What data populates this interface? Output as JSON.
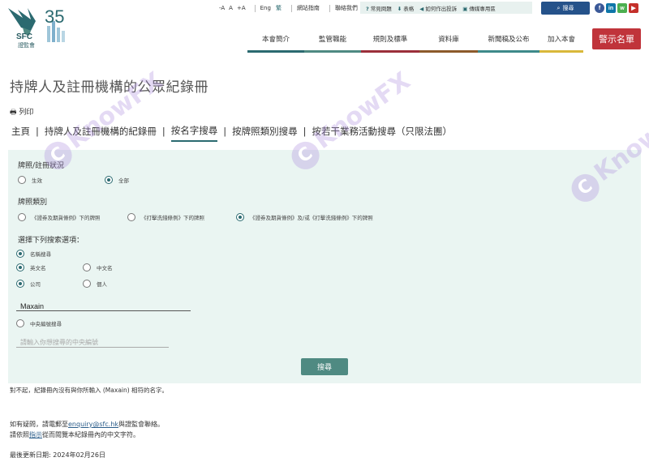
{
  "header": {
    "logo_number": "35",
    "logo_name": "SFC",
    "logo_sub": "證監會",
    "font_sizes": [
      "-A",
      "A",
      "+A"
    ],
    "language": "Eng",
    "language_alt": "繁",
    "site_guide": "網站指南",
    "contact_us": "聯絡我們",
    "quick_links": [
      "常見問題",
      "表格",
      "如何作出投訴",
      "傳媒專用區"
    ],
    "search_label": "搜尋",
    "social": [
      "f",
      "in",
      "w",
      "▶"
    ],
    "social_colors": [
      "#3b5998",
      "#0e76a8",
      "#4caf50",
      "#c4302b"
    ],
    "nav": [
      {
        "label": "本會簡介",
        "color": "#2b6a70"
      },
      {
        "label": "監管職能",
        "color": "#4f8a82"
      },
      {
        "label": "規則及標準",
        "color": "#9b2f3a"
      },
      {
        "label": "資料庫",
        "color": "#8c5a2b"
      },
      {
        "label": "新聞稿及公布",
        "color": "#3e8a8a"
      },
      {
        "label": "加入本會",
        "color": "#d9b83a"
      }
    ],
    "warning_button": "警示名單"
  },
  "page": {
    "title": "持牌人及註冊機構的公眾紀錄冊",
    "print_label": "列印",
    "tabs": [
      "主頁",
      "持牌人及註冊機構的紀錄冊",
      "按名字搜尋",
      "按牌照類別搜尋",
      "按若干業務活動搜尋（只限法團）"
    ],
    "active_tab": 2
  },
  "form": {
    "status_label": "牌照/註冊狀況",
    "status_options": [
      "生效",
      "全部"
    ],
    "status_selected": 1,
    "license_label": "牌照類別",
    "license_options": [
      "《證券及期貨條例》下的牌照",
      "《打擊洗錢條例》下的牌照",
      "《證券及期貨條例》及/或《打擊洗錢條例》下的牌照"
    ],
    "license_selected": 2,
    "search_options_label": "選擇下列搜索選項：",
    "name_search_label": "名稱搜尋",
    "lang_options": [
      "英文名",
      "中文名"
    ],
    "lang_selected": 0,
    "type_options": [
      "公司",
      "個人"
    ],
    "type_selected": 0,
    "name_value": "Maxain",
    "ce_search_label": "中央編號搜尋",
    "ce_placeholder": "請輸入你想搜尋的中央編號",
    "submit_label": "搜尋"
  },
  "result": {
    "message": "對不起，紀錄冊內沒有與你所輸入 (Maxain) 相符的名字。"
  },
  "footer": {
    "contact_prefix": "如有疑問，請電郵至",
    "contact_email": "enquiry@sfc.hk",
    "contact_suffix": "與證監會聯絡。",
    "guide_prefix": "請依照",
    "guide_link": "指示",
    "guide_suffix": "從而閱覽本紀錄冊內的中文字符。",
    "updated_label": "最後更新日期: 2024年02月26日"
  },
  "watermark": "KnowFX"
}
